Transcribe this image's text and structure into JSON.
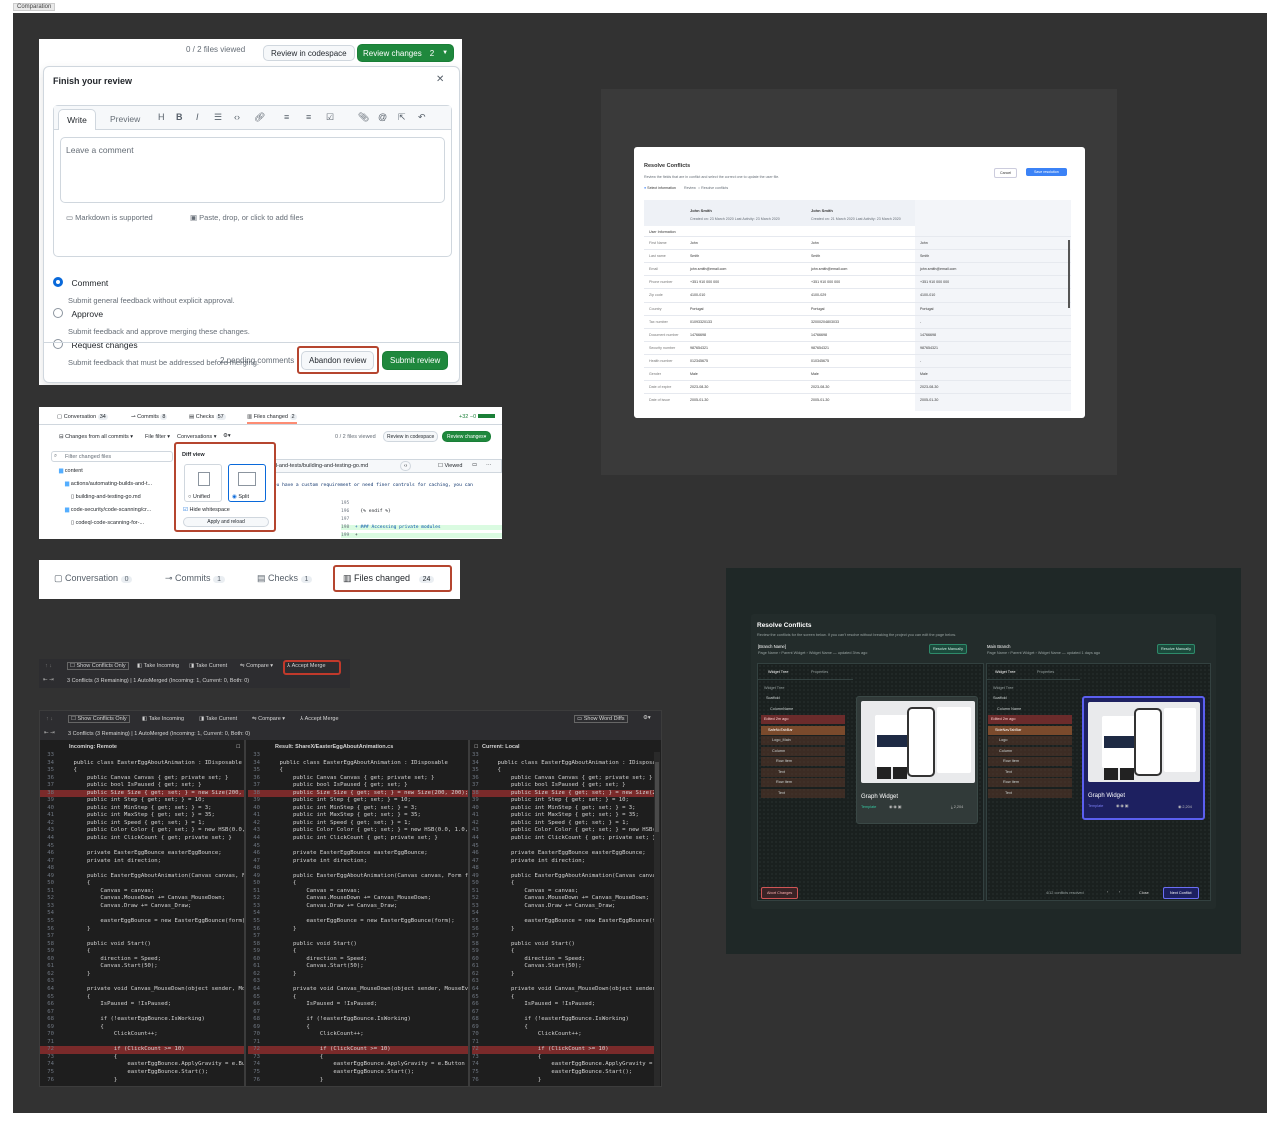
{
  "canvas_tag": "Comparation",
  "review": {
    "files_viewed": "0 / 2 files viewed",
    "codespace_btn": "Review in codespace",
    "review_changes_btn": "Review changes",
    "review_changes_count": "2",
    "title": "Finish your review",
    "write_tab": "Write",
    "preview_tab": "Preview",
    "comment_placeholder": "Leave a comment",
    "markdown_note": "Markdown is supported",
    "attach_note": "Paste, drop, or click to add files",
    "options": [
      {
        "label": "Comment",
        "desc": "Submit general feedback without explicit approval."
      },
      {
        "label": "Approve",
        "desc": "Submit feedback and approve merging these changes."
      },
      {
        "label": "Request changes",
        "desc": "Submit feedback that must be addressed before merging."
      }
    ],
    "pending": "2 pending comments",
    "abandon_btn": "Abandon review",
    "submit_btn": "Submit review"
  },
  "files_panel": {
    "tabs": [
      {
        "label": "Conversation",
        "count": "34"
      },
      {
        "label": "Commits",
        "count": "8"
      },
      {
        "label": "Checks",
        "count": "57"
      },
      {
        "label": "Files changed",
        "count": "2"
      }
    ],
    "diffstat": "+32 −0",
    "toolbar": {
      "changes": "Changes from all commits",
      "file_filter": "File filter",
      "conversations": "Conversations"
    },
    "viewed": "0 / 2 files viewed",
    "codespace": "Review in codespace",
    "review_changes": "Review changes",
    "filter_placeholder": "Filter changed files",
    "tree": [
      "content",
      "actions/automating-builds-and-t...",
      "building-and-testing-go.md",
      "code-security/code-scanning/cr...",
      "codeql-code-scanning-for-..."
    ],
    "diff_view": {
      "title": "Diff view",
      "unified": "Unified",
      "split": "Split",
      "hide_ws": "Hide whitespace",
      "apply": "Apply and reload"
    },
    "file_path": "d-and-tests/building-and-testing-go.md",
    "viewed_label": "Viewed",
    "diff_lines": [
      {
        "num": "",
        "text": "you have a custom requirement or need finer controls for caching, you can"
      },
      {
        "num": "195",
        "text": ""
      },
      {
        "num": "196",
        "text": "  {% endif %}"
      },
      {
        "num": "197",
        "text": ""
      },
      {
        "num": "198",
        "text": "+ ### Accessing private modules"
      },
      {
        "num": "199",
        "text": "+"
      }
    ]
  },
  "tabs_zoom": {
    "tabs": [
      {
        "label": "Conversation",
        "count": "0"
      },
      {
        "label": "Commits",
        "count": "1"
      },
      {
        "label": "Checks",
        "count": "1"
      },
      {
        "label": "Files changed",
        "count": "24"
      }
    ]
  },
  "vs_mini": {
    "show_conflicts": "Show Conflicts Only",
    "take_incoming": "Take Incoming",
    "take_current": "Take Current",
    "compare": "Compare",
    "accept_merge": "Accept Merge",
    "status": "3 Conflicts (3 Remaining) | 1 AutoMerged (Incoming: 1, Current: 0, Both: 0)"
  },
  "vs_merge": {
    "show_conflicts": "Show Conflicts Only",
    "take_incoming": "Take Incoming",
    "take_current": "Take Current",
    "compare": "Compare",
    "accept_merge": "Accept Merge",
    "show_word_diffs": "Show Word Diffs",
    "status": "3 Conflicts (3 Remaining) | 1 AutoMerged (Incoming: 1, Current: 0, Both: 0)",
    "incoming_header": "Incoming: Remote",
    "result_header": "Result: ShareX/EasterEggAboutAnimation.cs",
    "current_header": "Current: Local",
    "incoming_start": 33,
    "result_start": 33,
    "current_start": 33,
    "lines": [
      {
        "t": "",
        "c": ""
      },
      {
        "t": "    public class EasterEggAboutAnimation : IDisposable",
        "c": ""
      },
      {
        "t": "    {",
        "c": ""
      },
      {
        "t": "        public Canvas Canvas { get; private set; }",
        "c": ""
      },
      {
        "t": "        public bool IsPaused { get; set; }",
        "c": ""
      },
      {
        "t": "        public Size Size { get; set; } = new Size(200, 200);",
        "c": "conflict"
      },
      {
        "t": "        public int Step { get; set; } = 10;",
        "c": ""
      },
      {
        "t": "        public int MinStep { get; set; } = 3;",
        "c": ""
      },
      {
        "t": "        public int MaxStep { get; set; } = 35;",
        "c": ""
      },
      {
        "t": "        public int Speed { get; set; } = 1;",
        "c": ""
      },
      {
        "t": "        public Color Color { get; set; } = new HSB(0.0, 1.0, 0.9);",
        "c": ""
      },
      {
        "t": "        public int ClickCount { get; private set; }",
        "c": ""
      },
      {
        "t": "",
        "c": ""
      },
      {
        "t": "        private EasterEggBounce easterEggBounce;",
        "c": ""
      },
      {
        "t": "        private int direction;",
        "c": ""
      },
      {
        "t": "",
        "c": ""
      },
      {
        "t": "        public EasterEggAboutAnimation(Canvas canvas, Form form)",
        "c": ""
      },
      {
        "t": "        {",
        "c": ""
      },
      {
        "t": "            Canvas = canvas;",
        "c": ""
      },
      {
        "t": "            Canvas.MouseDown += Canvas_MouseDown;",
        "c": ""
      },
      {
        "t": "            Canvas.Draw += Canvas_Draw;",
        "c": ""
      },
      {
        "t": "",
        "c": ""
      },
      {
        "t": "            easterEggBounce = new EasterEggBounce(form);",
        "c": ""
      },
      {
        "t": "        }",
        "c": ""
      },
      {
        "t": "",
        "c": ""
      },
      {
        "t": "        public void Start()",
        "c": ""
      },
      {
        "t": "        {",
        "c": ""
      },
      {
        "t": "            direction = Speed;",
        "c": ""
      },
      {
        "t": "            Canvas.Start(50);",
        "c": ""
      },
      {
        "t": "        }",
        "c": ""
      },
      {
        "t": "",
        "c": ""
      },
      {
        "t": "        private void Canvas_MouseDown(object sender, MouseEventArgs e)",
        "c": ""
      },
      {
        "t": "        {",
        "c": ""
      },
      {
        "t": "            IsPaused = !IsPaused;",
        "c": ""
      },
      {
        "t": "",
        "c": ""
      },
      {
        "t": "            if (!easterEggBounce.IsWorking)",
        "c": ""
      },
      {
        "t": "            {",
        "c": ""
      },
      {
        "t": "                ClickCount++;",
        "c": ""
      },
      {
        "t": "",
        "c": ""
      },
      {
        "t": "                if (ClickCount >= 10)",
        "c": "conflict"
      },
      {
        "t": "                {",
        "c": ""
      },
      {
        "t": "                    easterEggBounce.ApplyGravity = e.Button == MouseButtons.Left;",
        "c": ""
      },
      {
        "t": "                    easterEggBounce.Start();",
        "c": ""
      },
      {
        "t": "                }",
        "c": ""
      }
    ]
  },
  "resolve_light": {
    "title": "Resolve Conflicts",
    "subtitle": "Review the fields that are in conflict and select the correct one to update the user file.",
    "cancel": "Cancel",
    "save": "Save resolution",
    "legend_a": "Select information",
    "legend_b": "Review",
    "legend_c": "Resolve conflicts",
    "section": "User Information",
    "cols": [
      {
        "name": "John Smith",
        "meta": "Created on: 23 March 2020    Last Activity: 23 March 2020"
      },
      {
        "name": "John Smith",
        "meta": "Created on: 21 March 2020    Last Activity: 23 March 2020"
      },
      {
        "name": "John Smith",
        "meta": "New Summary"
      }
    ],
    "rows": [
      {
        "label": "First Name",
        "a": "John",
        "b": "John",
        "c": "John"
      },
      {
        "label": "Last name",
        "a": "Smith",
        "b": "Smith",
        "c": "Smith"
      },
      {
        "label": "Email",
        "a": "john.smith@email.com",
        "b": "john.smith@email.com",
        "c": "john.smith@email.com"
      },
      {
        "label": "Phone number",
        "a": "+351 910 000 000",
        "b": "+351 910 000 000",
        "c": "+351 910 000 000"
      },
      {
        "label": "Zip code",
        "a": "4100-010",
        "b": "4100-029",
        "c": "4100-010"
      },
      {
        "label": "Country",
        "a": "Portugal",
        "b": "Portugal",
        "c": "Portugal"
      },
      {
        "label": "Tax number",
        "a": "01093320133",
        "b": "32000204803033",
        "c": "-"
      },
      {
        "label": "Document number",
        "a": "14766698",
        "b": "14766698",
        "c": "14766698"
      },
      {
        "label": "Security number",
        "a": "987654321",
        "b": "987654321",
        "c": "987654321"
      },
      {
        "label": "Health number",
        "a": "012345675",
        "b": "010345675",
        "c": "-"
      },
      {
        "label": "Gender",
        "a": "Male",
        "b": "Male",
        "c": "Male"
      },
      {
        "label": "Date of expire",
        "a": "2023-08-30",
        "b": "2023-08-30",
        "c": "2023-08-30"
      },
      {
        "label": "Date of issue",
        "a": "2005-01-30",
        "b": "2005-01-30",
        "c": "2005-01-30"
      }
    ]
  },
  "resolve_dark": {
    "title": "Resolve Conflicts",
    "subtitle": "Review the conflicts for the screen below. If you can't resolve without breaking the project you can edit the page below.",
    "left": {
      "branch": "[Branch Name]",
      "crumb": "Page Name › Parent Widget › Widget Name — updated 3hrs ago",
      "btn": "Resolve Manually",
      "tab1": "Widget Tree",
      "tab2": "Properties"
    },
    "right": {
      "branch": "Main Branch",
      "crumb": "Page Name › Parent Widget › Widget Name — updated 1 days ago",
      "btn": "Resolve Manually",
      "tab1": "Widget Tree",
      "tab2": "Properties"
    },
    "tree_title": "Widget Tree",
    "tree_left": [
      "Scaffold",
      "ColumnName",
      "Edited 2m ago",
      "SafeNoTabBar",
      "Logo_Main",
      "Column",
      "Row Item",
      "Text",
      "Row Item",
      "Text"
    ],
    "tree_right": [
      "Scaffold",
      "Column Name",
      "Edited 2m ago",
      "SideNavTabBar",
      "Logo",
      "Column",
      "Row Item",
      "Text",
      "Row Item",
      "Text"
    ],
    "card_title": "Graph Widget",
    "card_sub": "Template",
    "count_left": "2,204",
    "count_right": "2,204",
    "abort": "Abort Changes",
    "resolved": "4/12 conflicts resolved",
    "close": "Close",
    "next": "Next Conflict"
  }
}
